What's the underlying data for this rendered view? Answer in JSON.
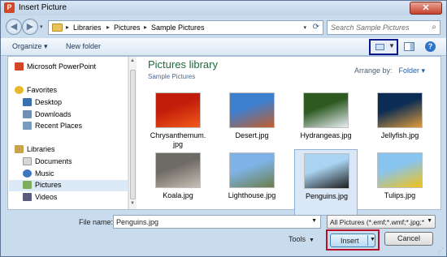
{
  "window": {
    "title": "Insert Picture",
    "close_glyph": "✕",
    "app_icon_letter": "P"
  },
  "address": {
    "crumbs": [
      "Libraries",
      "Pictures",
      "Sample Pictures"
    ],
    "separator": "▸"
  },
  "search": {
    "placeholder": "Search Sample Pictures"
  },
  "toolbar": {
    "organize": "Organize ▾",
    "new_folder": "New folder"
  },
  "nav": {
    "items": [
      {
        "label": "Microsoft PowerPoint",
        "icon": "powerpoint-icon",
        "color": "#d24726"
      },
      {
        "label": "Favorites",
        "icon": "star-icon",
        "color": "#e8b82a"
      },
      {
        "label": "Desktop",
        "icon": "desktop-icon",
        "color": "#3c6fb0"
      },
      {
        "label": "Downloads",
        "icon": "downloads-icon",
        "color": "#6f8fb5"
      },
      {
        "label": "Recent Places",
        "icon": "recent-places-icon",
        "color": "#7a9bc0"
      },
      {
        "label": "Libraries",
        "icon": "libraries-icon",
        "color": "#c9a44a"
      },
      {
        "label": "Documents",
        "icon": "documents-icon",
        "color": "#d7d7d7"
      },
      {
        "label": "Music",
        "icon": "music-icon",
        "color": "#3d77c2"
      },
      {
        "label": "Pictures",
        "icon": "pictures-icon",
        "color": "#7cae5d"
      },
      {
        "label": "Videos",
        "icon": "videos-icon",
        "color": "#5a5a7a"
      }
    ],
    "selected": "Pictures"
  },
  "library": {
    "title": "Pictures library",
    "subtitle": "Sample Pictures",
    "arrange_label": "Arrange by:",
    "arrange_value": "Folder ▾"
  },
  "files": [
    {
      "name": "Chrysanthemum.",
      "name2": "jpg",
      "colors": [
        "#c21d0a",
        "#f25b1a"
      ]
    },
    {
      "name": "Desert.jpg",
      "name2": "",
      "colors": [
        "#3d7fcf",
        "#c25e2a"
      ]
    },
    {
      "name": "Hydrangeas.jpg",
      "name2": "",
      "colors": [
        "#2e5a22",
        "#e9eef6"
      ]
    },
    {
      "name": "Jellyfish.jpg",
      "name2": "",
      "colors": [
        "#0b2d55",
        "#e09a3a"
      ]
    },
    {
      "name": "Koala.jpg",
      "name2": "",
      "colors": [
        "#6e6a64",
        "#c7c2b6"
      ]
    },
    {
      "name": "Lighthouse.jpg",
      "name2": "",
      "colors": [
        "#7fb3e8",
        "#6b7d4a"
      ]
    },
    {
      "name": "Penguins.jpg",
      "name2": "",
      "colors": [
        "#a9d3f0",
        "#1c1c1c"
      ]
    },
    {
      "name": "Tulips.jpg",
      "name2": "",
      "colors": [
        "#87c5ef",
        "#f1c21a"
      ]
    }
  ],
  "selected_file": "Penguins.jpg",
  "footer": {
    "file_name_label": "File name:",
    "file_name_value": "Penguins.jpg",
    "filter_value": "All Pictures (*.emf;*.wmf;*.jpg;*",
    "tools_label": "Tools",
    "insert_label": "Insert",
    "cancel_label": "Cancel"
  }
}
